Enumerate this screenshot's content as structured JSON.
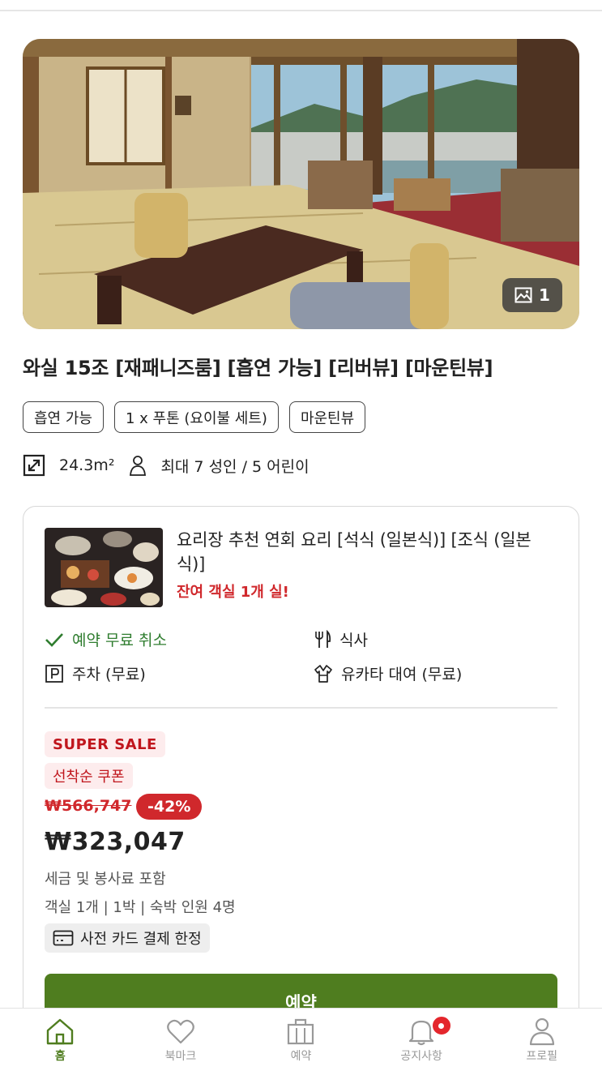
{
  "hero": {
    "photo_count": "1"
  },
  "room": {
    "title": "와실 15조 [재패니즈룸] [흡연 가능] [리버뷰] [마운틴뷰]",
    "tags": [
      "흡연 가능",
      "1 x 푸톤 (요이불 세트)",
      "마운틴뷰"
    ],
    "area": "24.3m²",
    "occupancy": "최대 7 성인 / 5 어린이"
  },
  "plan": {
    "title": "요리장 추천 연회 요리 [석식 (일본식)] [조식 (일본식)]",
    "remaining": "잔여 객실 1개 실!",
    "amenities": {
      "cancel": "예약 무료 취소",
      "meal": "식사",
      "parking": "주차 (무료)",
      "yukata": "유카타 대여 (무료)"
    },
    "sale_badge": "SUPER SALE",
    "coupon_badge": "선착순 쿠폰",
    "original_price": "₩566,747",
    "discount": "-42%",
    "price": "₩323,047",
    "tax_note": "세금 및 봉사료 포함",
    "stay_info": "객실 1개 | 1박 | 숙박 인원 4명",
    "payment_note": "사전 카드 결제 한정",
    "book_label": "예약"
  },
  "tabbar": {
    "items": [
      {
        "label": "홈",
        "icon": "home-icon",
        "active": true
      },
      {
        "label": "북마크",
        "icon": "heart-icon",
        "active": false
      },
      {
        "label": "예약",
        "icon": "bag-icon",
        "active": false
      },
      {
        "label": "공지사항",
        "icon": "bell-icon",
        "active": false
      },
      {
        "label": "프로필",
        "icon": "person-icon",
        "active": false
      }
    ]
  },
  "colors": {
    "accent": "#4f7d1f",
    "sale_red": "#d0282c",
    "free_cancel_green": "#2f7d2f"
  }
}
